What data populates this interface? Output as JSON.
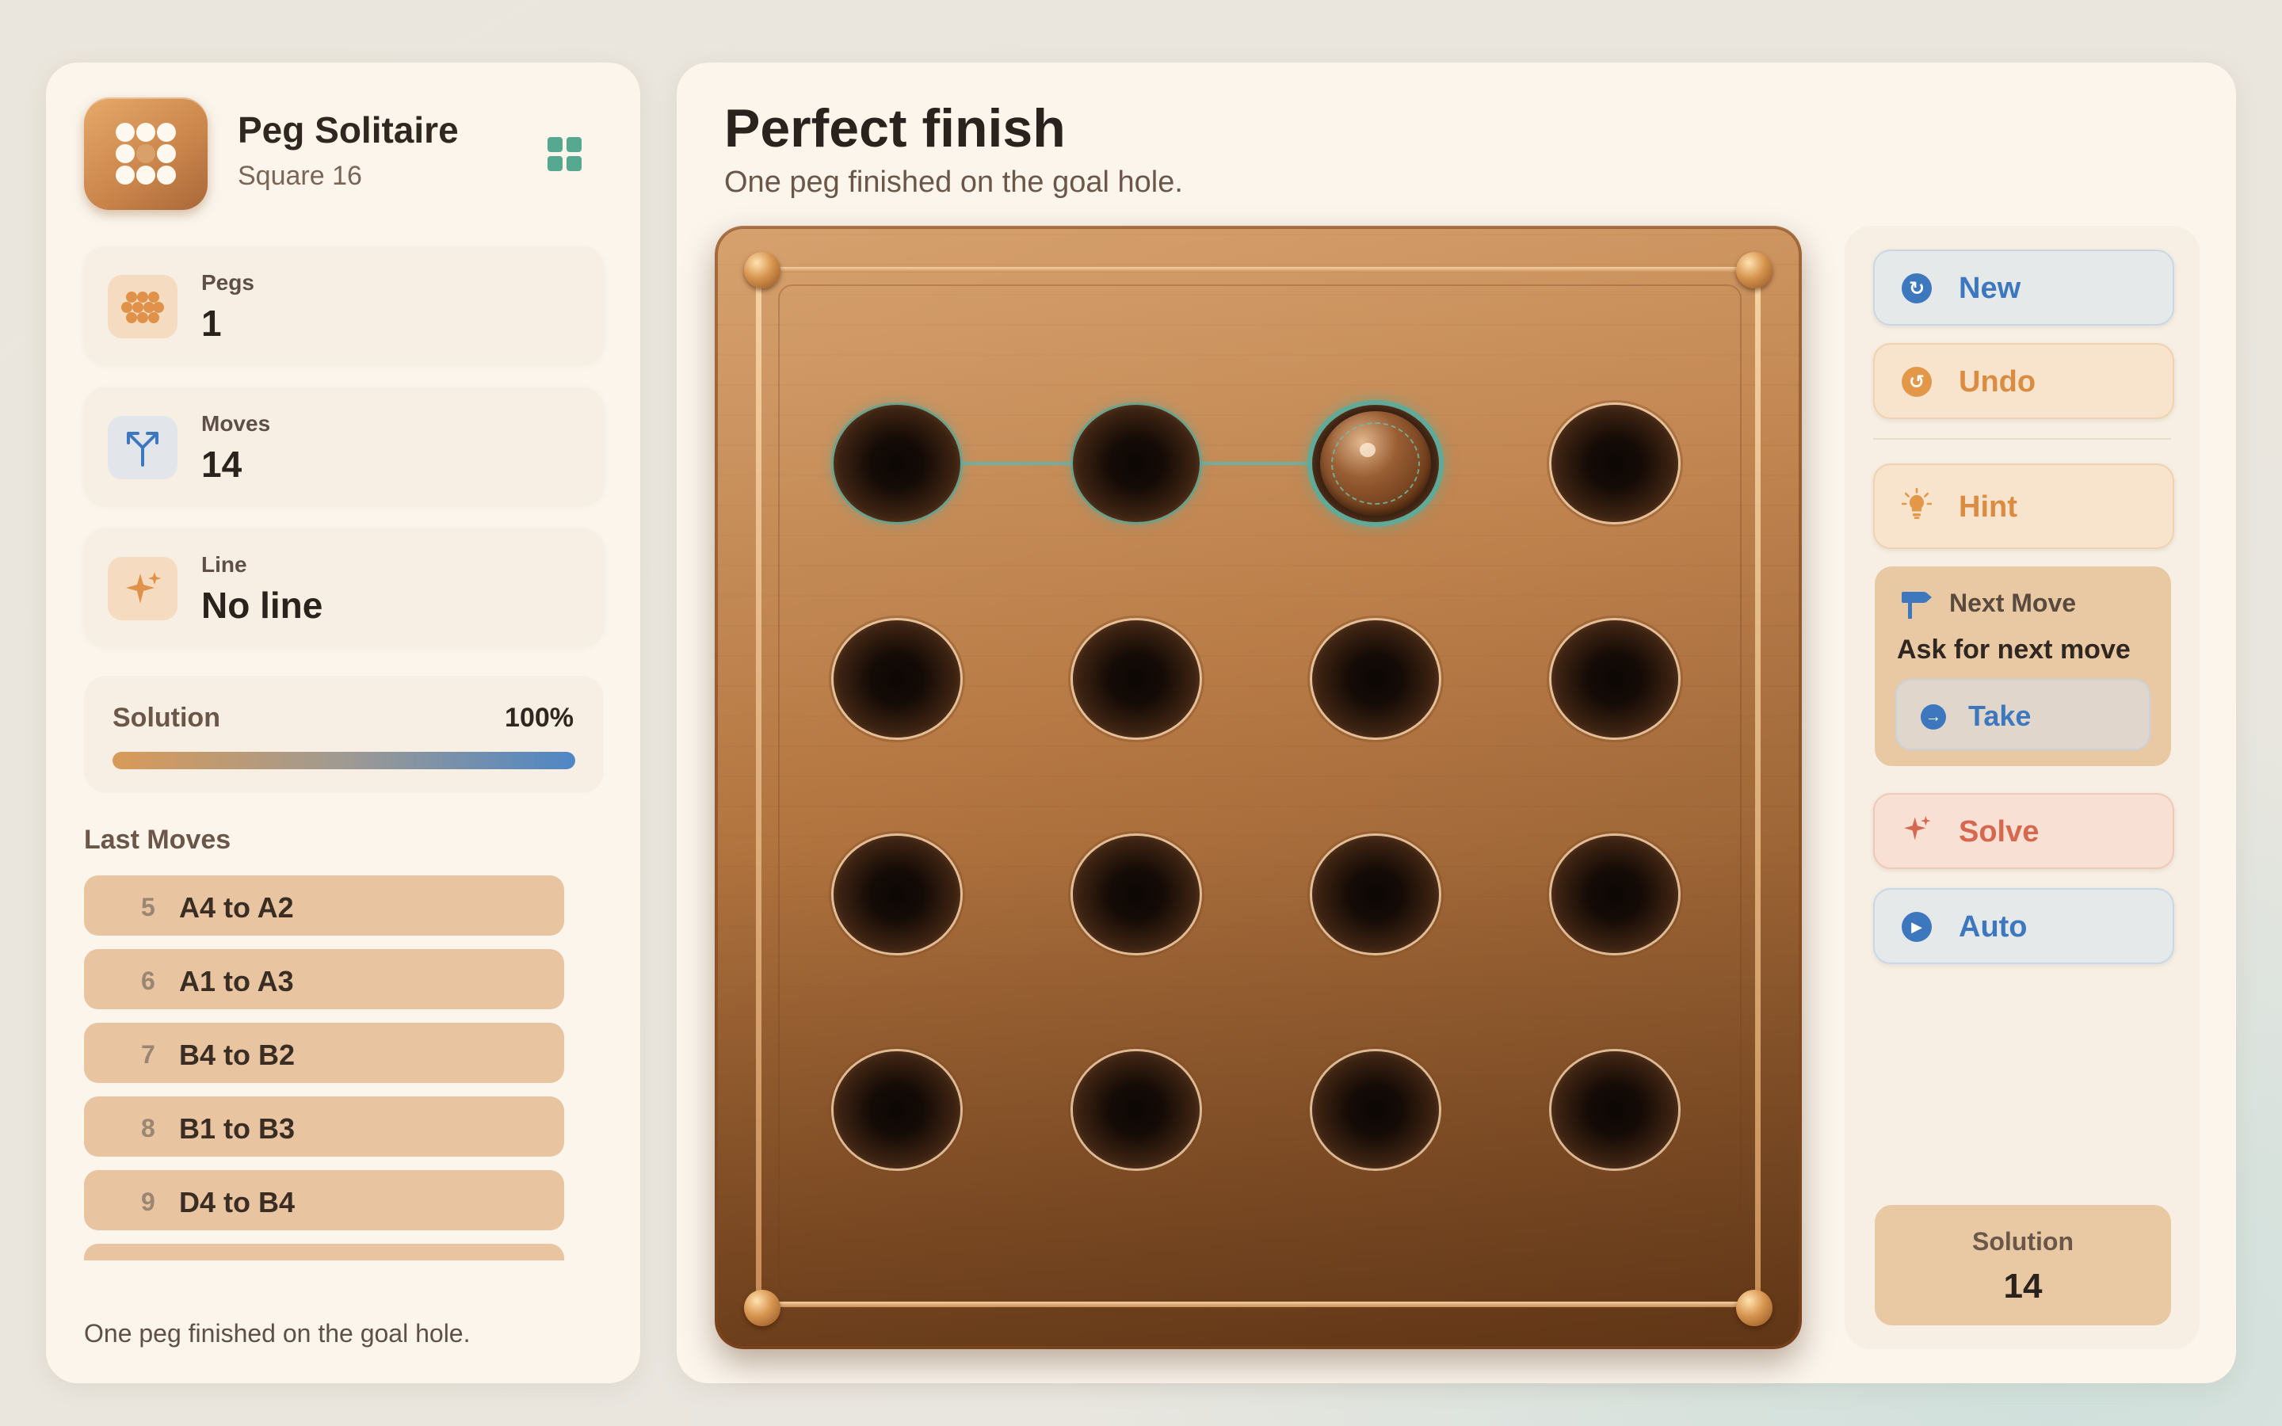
{
  "sidebar": {
    "app_title": "Peg Solitaire",
    "app_subtitle": "Square 16",
    "stats": [
      {
        "label": "Pegs",
        "value": "1",
        "icon": "pegs-cluster-icon"
      },
      {
        "label": "Moves",
        "value": "14",
        "icon": "fork-arrows-icon"
      },
      {
        "label": "Line",
        "value": "No line",
        "icon": "sparkle-icon"
      }
    ],
    "solution_label": "Solution",
    "solution_percent": "100%",
    "solution_progress": 1.0,
    "last_moves_title": "Last Moves",
    "last_moves": [
      {
        "num": "5",
        "text": "A4 to A2"
      },
      {
        "num": "6",
        "text": "A1 to A3"
      },
      {
        "num": "7",
        "text": "B4 to B2"
      },
      {
        "num": "8",
        "text": "B1 to B3"
      },
      {
        "num": "9",
        "text": "D4 to B4"
      },
      {
        "num": "",
        "text": ""
      }
    ],
    "footer": "One peg finished on the goal hole."
  },
  "main": {
    "title": "Perfect finish",
    "subtitle": "One peg finished on the goal hole."
  },
  "board": {
    "rows": 4,
    "cols": 4,
    "pegs": [
      [
        0,
        2
      ]
    ],
    "goal": [
      0,
      2
    ],
    "highlighted_line": [
      [
        0,
        0
      ],
      [
        0,
        1
      ],
      [
        0,
        2
      ]
    ]
  },
  "controls": {
    "new_label": "New",
    "undo_label": "Undo",
    "hint_label": "Hint",
    "next_move_title": "Next Move",
    "next_move_text": "Ask for next move",
    "take_label": "Take",
    "solve_label": "Solve",
    "auto_label": "Auto",
    "solution_label": "Solution",
    "solution_value": "14"
  },
  "colors": {
    "accent_teal": "#56a890",
    "accent_blue": "#3d78bf",
    "accent_orange": "#e29848",
    "accent_red": "#d5684e",
    "wood": "#b37540"
  }
}
